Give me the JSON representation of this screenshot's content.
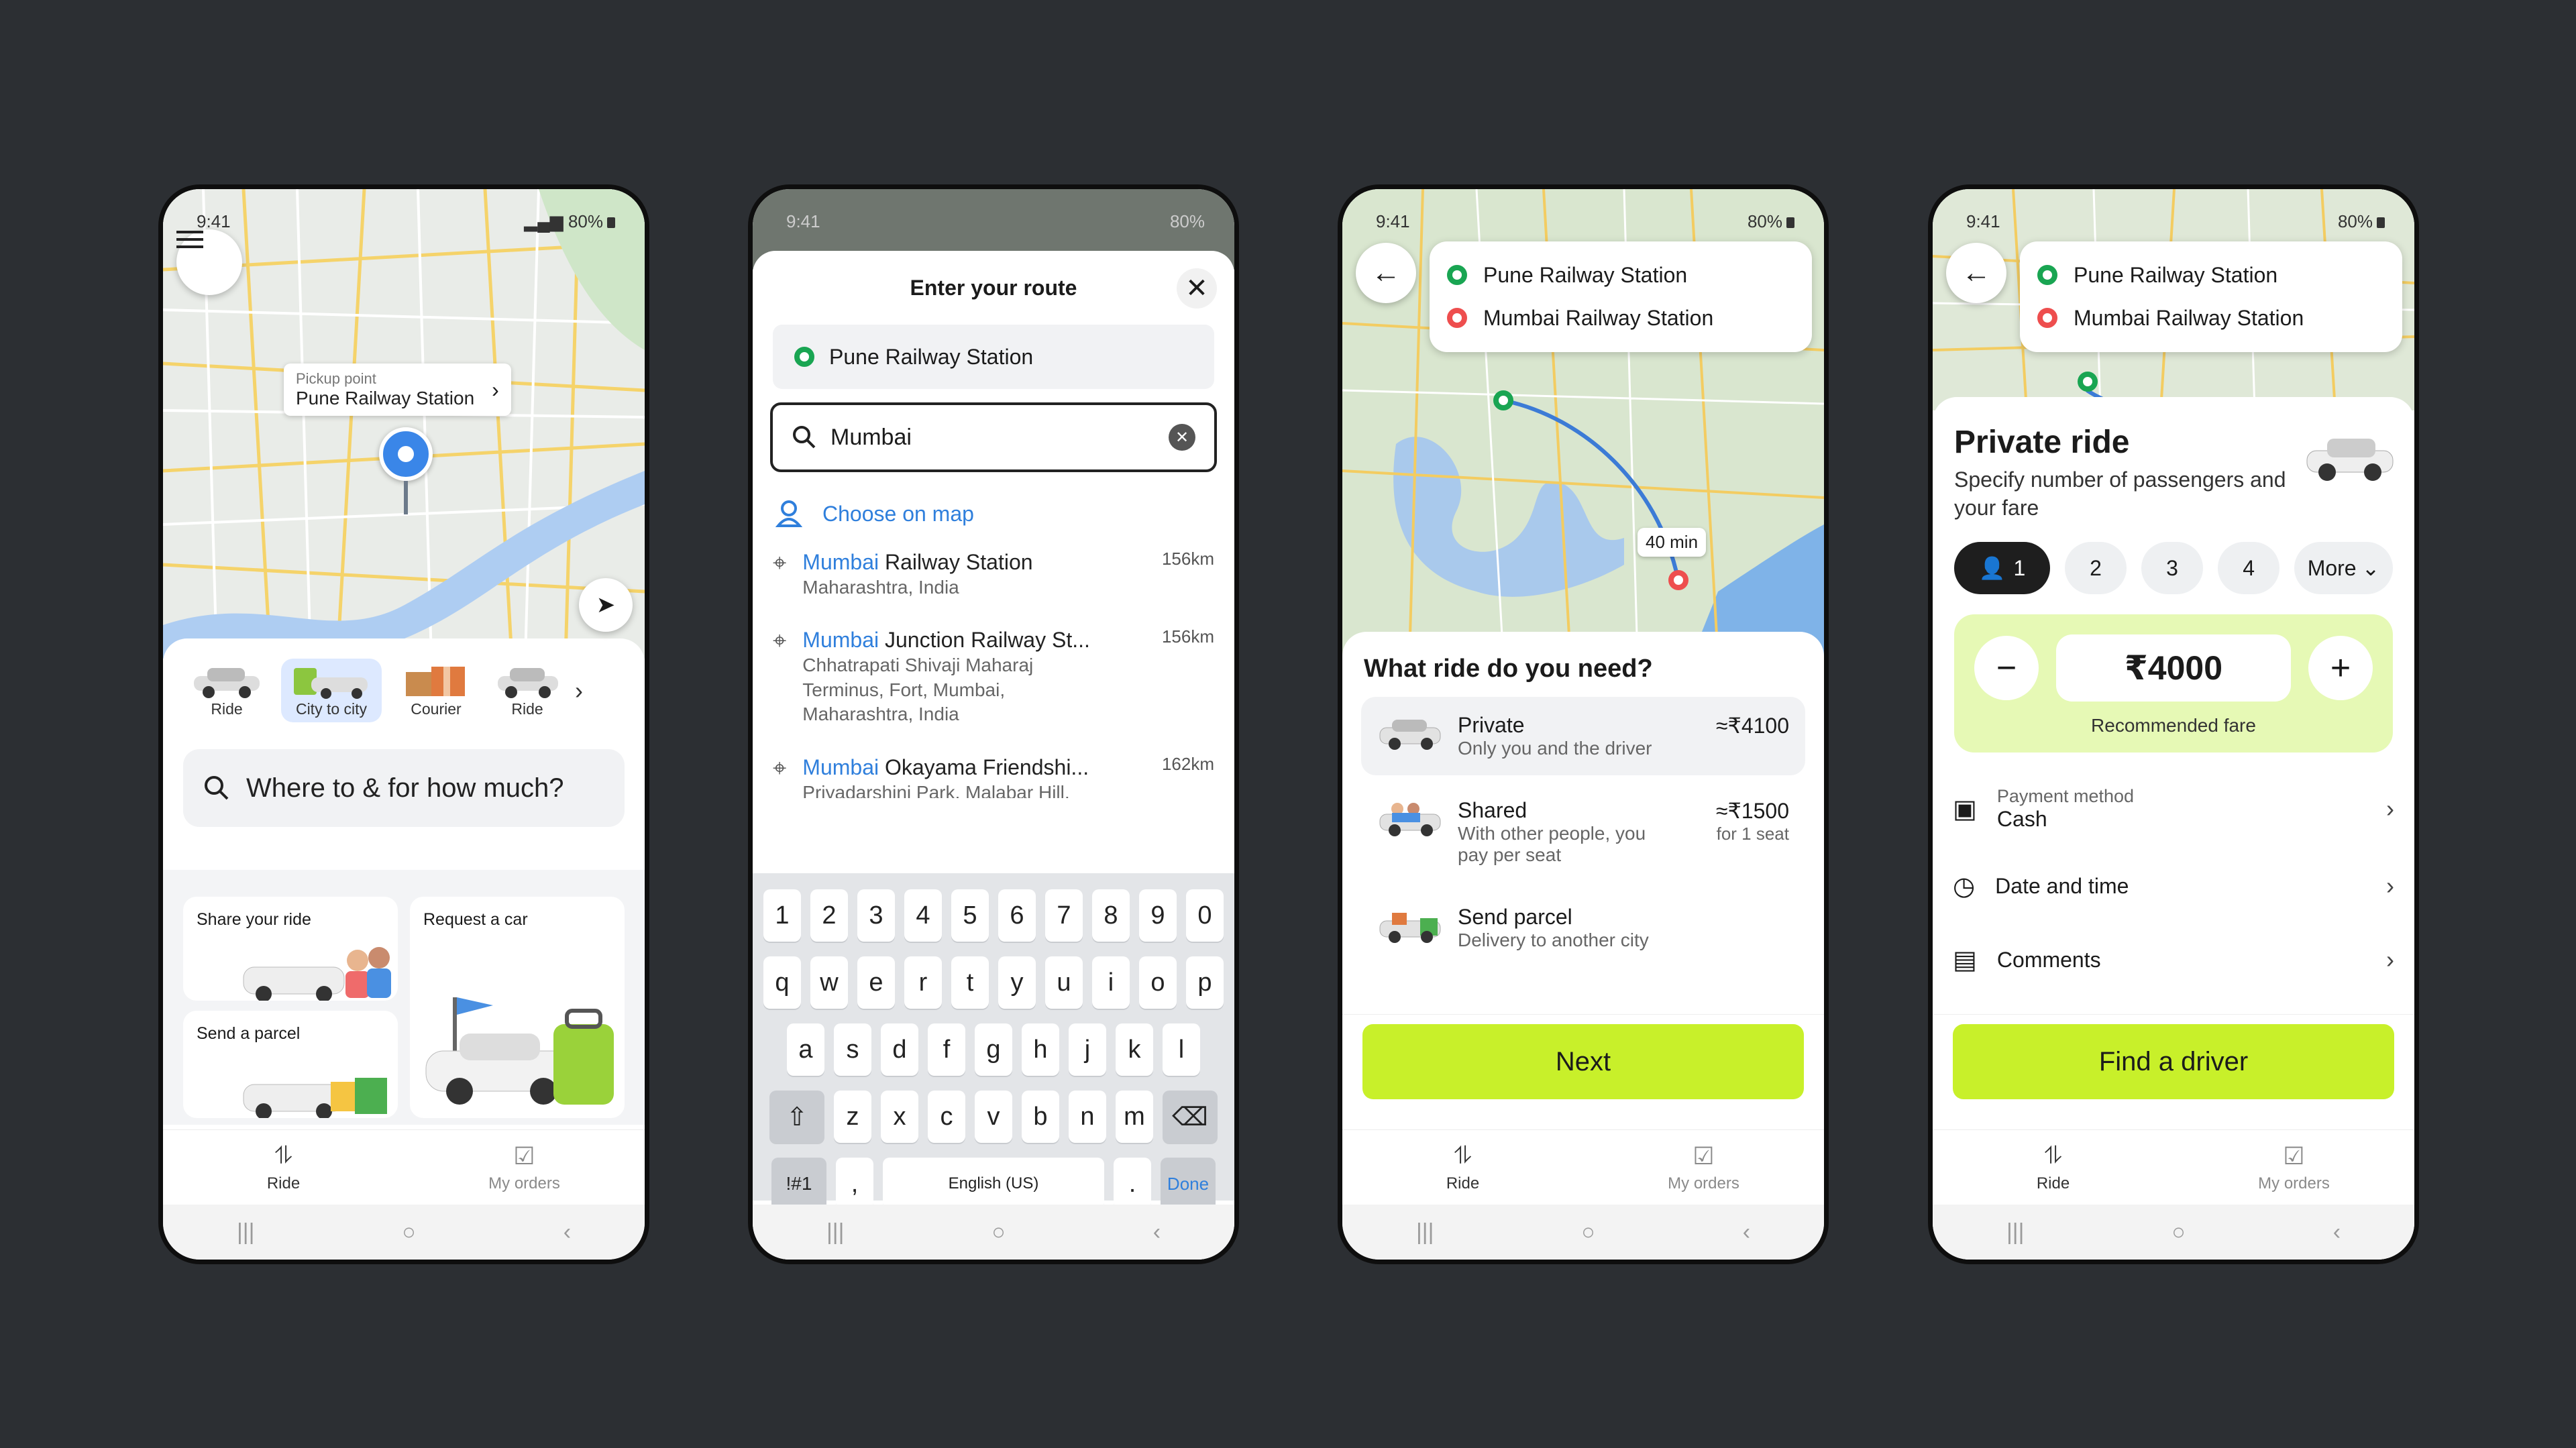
{
  "status": {
    "time": "9:41",
    "battery": "80%"
  },
  "screen1": {
    "pickup_label": "Pickup point",
    "pickup_value": "Pune Railway Station",
    "modes": [
      {
        "label": "Ride",
        "icon": "car-icon"
      },
      {
        "label": "City to city",
        "icon": "city-to-city-icon"
      },
      {
        "label": "Courier",
        "icon": "courier-box-icon"
      },
      {
        "label": "Ride",
        "icon": "car-icon"
      }
    ],
    "search_placeholder": "Where to & for how much?",
    "cards": {
      "share": "Share your ride",
      "request": "Request a car",
      "parcel": "Send a parcel"
    }
  },
  "nav": {
    "ride": "Ride",
    "orders": "My orders"
  },
  "screen2": {
    "title": "Enter your route",
    "from": "Pune Railway Station",
    "query": "Mumbai",
    "choose_map": "Choose on map",
    "suggestions": [
      {
        "match": "Mumbai",
        "rest": " Railway Station",
        "sub": "Maharashtra, India",
        "km": "156km"
      },
      {
        "match": "Mumbai",
        "rest": " Junction Railway St...",
        "sub": "Chhatrapati Shivaji Maharaj Terminus, Fort, Mumbai, Maharashtra, India",
        "km": "156km"
      },
      {
        "match": "Mumbai",
        "rest": " Okayama Friendshi...",
        "sub": "Priyadarshini Park, Malabar Hill,",
        "km": "162km"
      }
    ],
    "keyboard": {
      "row1": [
        "1",
        "2",
        "3",
        "4",
        "5",
        "6",
        "7",
        "8",
        "9",
        "0"
      ],
      "row2": [
        "q",
        "w",
        "e",
        "r",
        "t",
        "y",
        "u",
        "i",
        "o",
        "p"
      ],
      "row3": [
        "a",
        "s",
        "d",
        "f",
        "g",
        "h",
        "j",
        "k",
        "l"
      ],
      "row4": [
        "z",
        "x",
        "c",
        "v",
        "b",
        "n",
        "m"
      ],
      "sym": "!#1",
      "comma": ",",
      "space": "English (US)",
      "period": ".",
      "done": "Done"
    }
  },
  "route": {
    "from": "Pune Railway Station",
    "to": "Mumbai Railway Station"
  },
  "screen3": {
    "duration": "40 min",
    "question": "What ride do you need?",
    "options": [
      {
        "title": "Private",
        "sub": "Only you and the driver",
        "price": "≈₹4100",
        "note": ""
      },
      {
        "title": "Shared",
        "sub": "With other people, you pay per seat",
        "price": "≈₹1500",
        "note": "for 1 seat"
      },
      {
        "title": "Send parcel",
        "sub": "Delivery to another city",
        "price": "",
        "note": ""
      }
    ],
    "next": "Next"
  },
  "screen4": {
    "title": "Private ride",
    "subtitle": "Specify number of passengers and your fare",
    "passengers": [
      "1",
      "2",
      "3",
      "4"
    ],
    "more": "More",
    "fare": "₹4000",
    "fare_note": "Recommended fare",
    "payment_label": "Payment method",
    "payment_value": "Cash",
    "datetime": "Date and time",
    "comments": "Comments",
    "cta": "Find a driver"
  },
  "colors": {
    "accent": "#c8f02a",
    "green": "#19a552",
    "red": "#ee4e4e",
    "blue": "#2f7fdc"
  }
}
